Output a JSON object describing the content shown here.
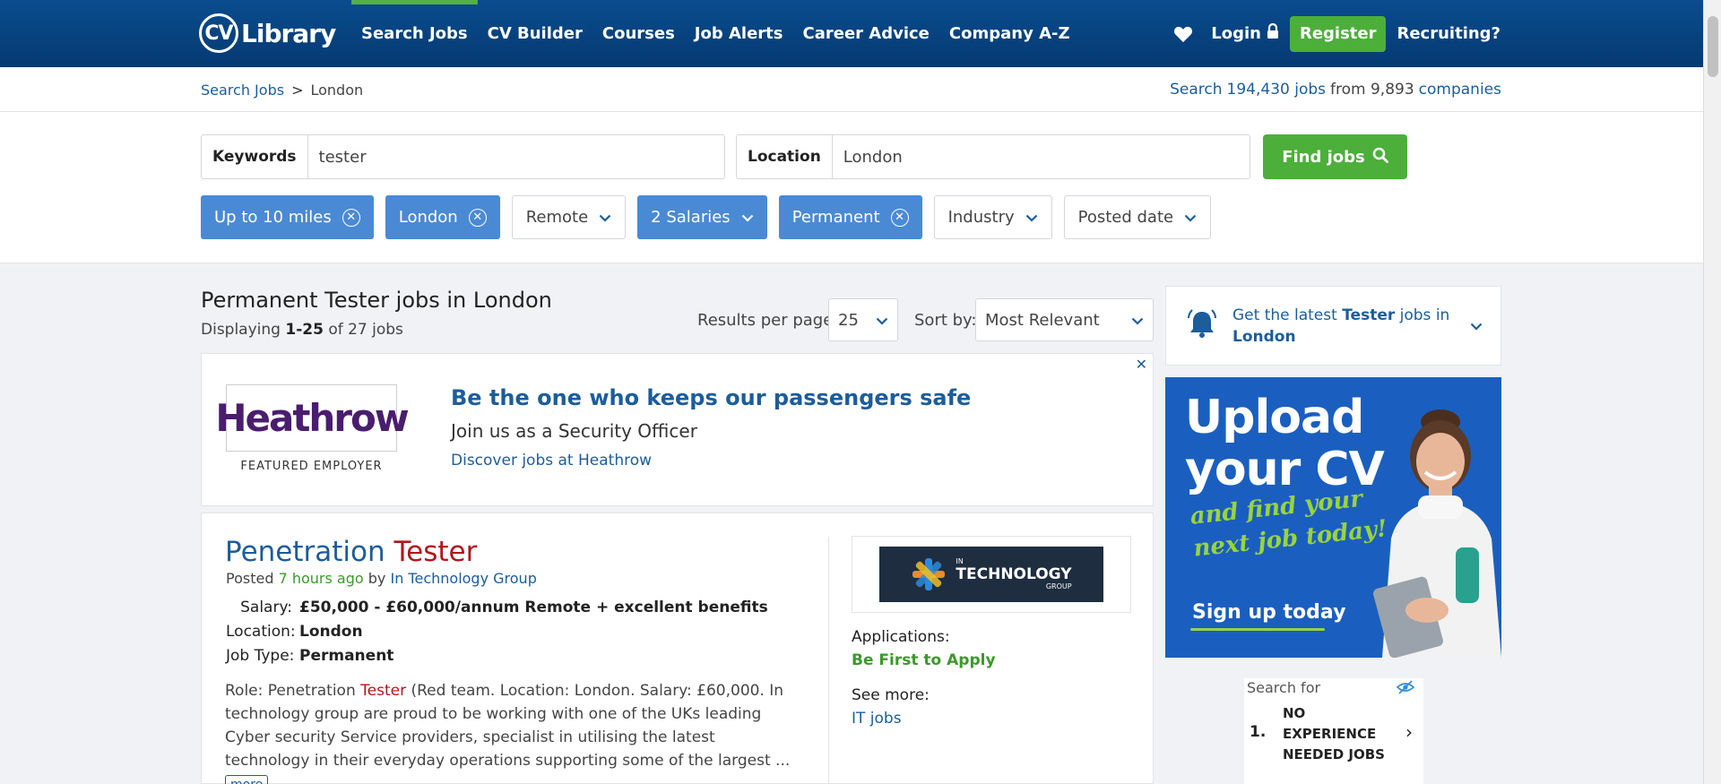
{
  "header": {
    "logo_cv": "CV",
    "logo_text": "Library",
    "nav": [
      "Search Jobs",
      "CV Builder",
      "Courses",
      "Job Alerts",
      "Career Advice",
      "Company A-Z"
    ],
    "login": "Login",
    "register": "Register",
    "recruiting": "Recruiting?"
  },
  "breadcrumb": {
    "root": "Search Jobs",
    "sep": ">",
    "current": "London"
  },
  "stats": {
    "prefix": "Search",
    "jobs": "194,430 jobs",
    "from": "from 9,893",
    "companies": "companies"
  },
  "search": {
    "keywords_label": "Keywords",
    "keywords_value": "tester",
    "location_label": "Location",
    "location_value": "London",
    "find_label": "Find jobs"
  },
  "filters": [
    {
      "label": "Up to 10 miles",
      "active": true,
      "type": "clear"
    },
    {
      "label": "London",
      "active": true,
      "type": "clear"
    },
    {
      "label": "Remote",
      "active": false,
      "type": "dropdown"
    },
    {
      "label": "2 Salaries",
      "active": true,
      "type": "dropdown"
    },
    {
      "label": "Permanent",
      "active": true,
      "type": "clear"
    },
    {
      "label": "Industry",
      "active": false,
      "type": "dropdown"
    },
    {
      "label": "Posted date",
      "active": false,
      "type": "dropdown"
    }
  ],
  "results": {
    "title": "Permanent Tester jobs in London",
    "displaying": "Displaying",
    "range": "1-25",
    "of": "of 27 jobs",
    "rpp_label": "Results per page:",
    "rpp_value": "25",
    "sort_label": "Sort by:",
    "sort_value": "Most Relevant"
  },
  "alert": {
    "pre": "Get the latest",
    "kw": "Tester",
    "mid": "jobs in",
    "loc": "London"
  },
  "promo": {
    "line1": "Upload",
    "line2": "your CV",
    "tag1": "and find your",
    "tag2": "next job today!",
    "cta": "Sign up today"
  },
  "search_for": {
    "heading": "Search for",
    "num": "1.",
    "item": "NO EXPERIENCE NEEDED JOBS"
  },
  "ad": {
    "close": "✕",
    "logo": "Heathrow",
    "featured": "FEATURED EMPLOYER",
    "title": "Be the one who keeps our passengers safe",
    "subtitle": "Join us as a Security Officer",
    "link": "Discover jobs at Heathrow"
  },
  "job": {
    "title_a": "Penetration ",
    "title_b": "Tester",
    "posted": "Posted",
    "time": "7 hours ago",
    "by": "by",
    "company": "In Technology Group",
    "salary_k": "Salary:",
    "salary_v": "£50,000 - £60,000/annum Remote + excellent benefits",
    "location_k": "Location:",
    "location_v": "London",
    "type_k": "Job Type:",
    "type_v": "Permanent",
    "desc_a": "Role: Penetration ",
    "desc_hl": "Tester",
    "desc_b": " (Red team. Location: London. Salary: £60,000. In technology group are proud to be working with one of the UKs leading Cyber security Service providers, specialist in utilising the latest technology in their everyday operations supporting some of the largest ...",
    "more": "more",
    "logo_line1": "IN",
    "logo_line2": "TECHNOLOGY",
    "logo_line3": "GROUP",
    "applications_label": "Applications:",
    "applications_value": "Be First to Apply",
    "see_more_label": "See more:",
    "see_more_link": "IT jobs"
  }
}
